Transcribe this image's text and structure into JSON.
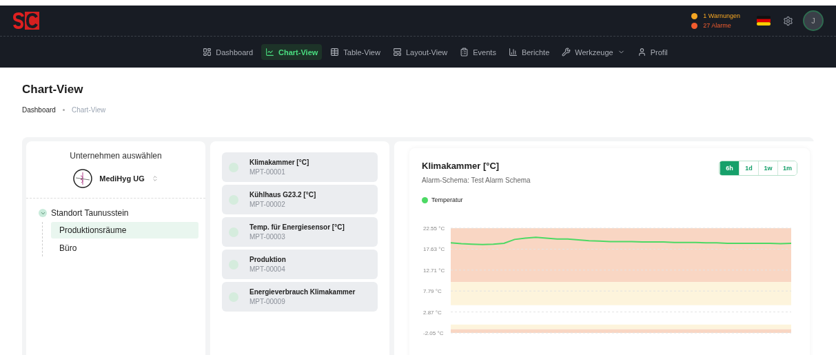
{
  "header": {
    "warnings": "1 Warnungen",
    "alarms": "27 Alarme",
    "avatar": "J"
  },
  "nav": [
    {
      "label": "Dashboard",
      "selected": false,
      "dropdown": false
    },
    {
      "label": "Chart-View",
      "selected": true,
      "dropdown": false
    },
    {
      "label": "Table-View",
      "selected": false,
      "dropdown": false
    },
    {
      "label": "Layout-View",
      "selected": false,
      "dropdown": false
    },
    {
      "label": "Events",
      "selected": false,
      "dropdown": false
    },
    {
      "label": "Berichte",
      "selected": false,
      "dropdown": false
    },
    {
      "label": "Werkzeuge",
      "selected": false,
      "dropdown": true
    },
    {
      "label": "Profil",
      "selected": false,
      "dropdown": false
    }
  ],
  "page_title": "Chart-View",
  "breadcrumb": [
    "Dashboard",
    "Chart-View"
  ],
  "company_panel": {
    "heading": "Unternehmen auswählen",
    "company": "MediHyg UG",
    "tree": [
      {
        "label": "Standort Taunusstein",
        "expanded": true,
        "selected": false,
        "children": [
          {
            "label": "Produktionsräume",
            "selected": true
          },
          {
            "label": "Büro",
            "selected": false
          }
        ]
      }
    ]
  },
  "sensors": [
    {
      "name": "Klimakammer [°C]",
      "id": "MPT-00001"
    },
    {
      "name": "Kühlhaus G23.2 [°C]",
      "id": "MPT-00002"
    },
    {
      "name": "Temp. für Energiesensor [°C]",
      "id": "MPT-00003"
    },
    {
      "name": "Produktion",
      "id": "MPT-00004"
    },
    {
      "name": "Energieverbrauch Klimakammer",
      "id": "MPT-00009"
    }
  ],
  "chart_card": {
    "title": "Klimakammer [°C]",
    "subtitle": "Alarm-Schema: Test Alarm Schema",
    "ranges": [
      {
        "label": "6h",
        "selected": true
      },
      {
        "label": "1d",
        "selected": false
      },
      {
        "label": "1w",
        "selected": false
      },
      {
        "label": "1m",
        "selected": false
      }
    ],
    "chart_data": {
      "type": "line",
      "grid": true,
      "ylim": [
        -2.05,
        22.55
      ],
      "yticks": [
        {
          "value": 22.55,
          "label": "22.55 °C"
        },
        {
          "value": 17.63,
          "label": "17.63 °C"
        },
        {
          "value": 12.71,
          "label": "12.71 °C"
        },
        {
          "value": 7.79,
          "label": "7.79 °C"
        },
        {
          "value": 2.87,
          "label": "2.87 °C"
        },
        {
          "value": -2.05,
          "label": "-2.05 °C"
        }
      ],
      "series": [
        {
          "name": "Temperatur",
          "color": "#4cd964",
          "values": [
            19.1,
            18.9,
            18.8,
            18.7,
            18.8,
            19.0,
            19.9,
            20.2,
            20.4,
            20.2,
            20.0,
            20.0,
            19.8,
            19.6,
            19.5,
            19.4,
            19.4,
            19.4,
            19.3,
            19.3,
            19.3,
            19.2,
            19.2,
            19.2,
            19.1,
            19.1,
            19.0,
            19.0,
            19.0,
            19.0,
            19.0,
            18.9,
            19.0
          ]
        }
      ]
    }
  }
}
